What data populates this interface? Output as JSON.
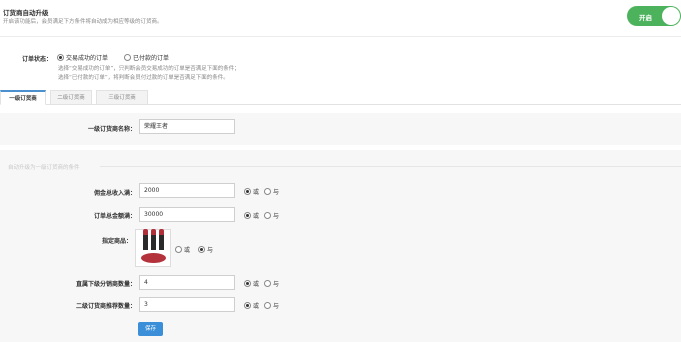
{
  "header": {
    "title": "订货商自动升级",
    "description": "开启该功能后，会员满足下方条件将自动成为相应等级的订货商。",
    "toggle_label": "开启",
    "toggle_on": true
  },
  "order_status": {
    "label": "订单状态：",
    "options": [
      {
        "label": "交易成功的订单",
        "selected": true
      },
      {
        "label": "已付款的订单",
        "selected": false
      }
    ],
    "hints": [
      "选择“交易成功的订单”，只判断会员交易成功的订单是否满足下面的条件；",
      "选择“已付款的订单”，将判断会员付过款的订单是否满足下面的条件。"
    ]
  },
  "tabs": [
    {
      "label": "一级订货商",
      "active": true
    },
    {
      "label": "二级订货商",
      "active": false
    },
    {
      "label": "三级订货商",
      "active": false
    }
  ],
  "name_field": {
    "label": "一级订货商名称：",
    "value": "荣耀王者"
  },
  "conditions_title": "自动升级为一级订货商的条件",
  "conditions": [
    {
      "label": "佣金总收入满：",
      "value": "2000",
      "or_label": "或",
      "and_label": "与",
      "selected": "or"
    },
    {
      "label": "订单总金额满：",
      "value": "30000",
      "or_label": "或",
      "and_label": "与",
      "selected": "or"
    },
    {
      "label": "直属下级分销商数量：",
      "value": "4",
      "or_label": "或",
      "and_label": "与",
      "selected": "or"
    },
    {
      "label": "二级订货商推荐数量：",
      "value": "3",
      "or_label": "或",
      "and_label": "与",
      "selected": "or"
    }
  ],
  "product": {
    "label": "指定商品：",
    "or_label": "或",
    "and_label": "与",
    "selected": "and"
  },
  "save_label": "保存"
}
